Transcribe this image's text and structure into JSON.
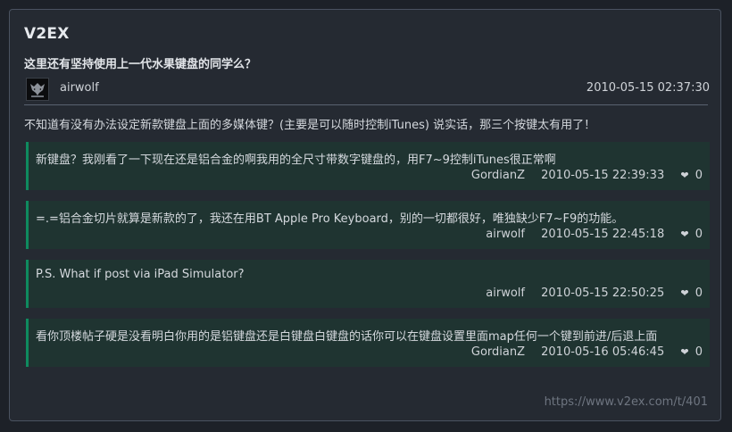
{
  "site": {
    "title": "V2EX"
  },
  "topic": {
    "title": "这里还有坚持使用上一代水果键盘的同学么？",
    "author": "airwolf",
    "time": "2010-05-15 02:37:30",
    "content": "不知道有没有办法设定新款键盘上面的多媒体键？(主要是可以随时控制iTunes) 说实话，那三个按键太有用了！"
  },
  "replies": [
    {
      "text": "新键盘？我刚看了一下现在还是铝合金的啊我用的全尺寸带数字键盘的，用F7~9控制iTunes很正常啊",
      "author": "GordianZ",
      "time": "2010-05-15 22:39:33",
      "likes": "0"
    },
    {
      "text": "=.=铝合金切片就算是新款的了，我还在用BT Apple Pro Keyboard，别的一切都很好，唯独缺少F7~F9的功能。",
      "author": "airwolf",
      "time": "2010-05-15 22:45:18",
      "likes": "0"
    },
    {
      "text": "P.S. What if post via iPad Simulator?",
      "author": "airwolf",
      "time": "2010-05-15 22:50:25",
      "likes": "0"
    },
    {
      "text": "看你顶楼帖子硬是没看明白你用的是铝键盘还是白键盘白键盘的话你可以在键盘设置里面map任何一个键到前进/后退上面",
      "author": "GordianZ",
      "time": "2010-05-16 05:46:45",
      "likes": "0"
    }
  ],
  "footer": {
    "url": "https://www.v2ex.com/t/401"
  },
  "icons": {
    "like": "heart-icon",
    "avatar": "wolf-avatar-icon"
  },
  "colors": {
    "accent": "#0f8a5f",
    "reply_bg": "#1f3431",
    "card_bg": "#252a32",
    "page_bg": "#1d2128"
  }
}
